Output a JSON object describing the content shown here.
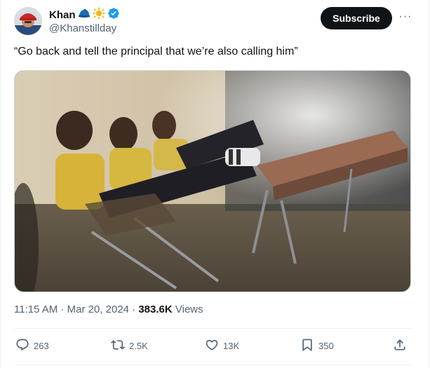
{
  "author": {
    "display_name": "Khan",
    "handle": "@Khanstillday",
    "badges": [
      "blue-cap-emoji-icon",
      "sun-emoji-icon",
      "verified-badge-icon"
    ]
  },
  "subscribe_label": "Subscribe",
  "more_label": "···",
  "tweet_text": "“Go back and tell the principal that we’re also calling him”",
  "meta": {
    "time": "11:15 AM",
    "separator1": " · ",
    "date": "Mar 20, 2024",
    "separator2": " · ",
    "views_count": "383.6K",
    "views_label": " Views"
  },
  "actions": {
    "reply": {
      "icon": "reply-icon",
      "count": "263"
    },
    "repost": {
      "icon": "repost-icon",
      "count": "2.5K"
    },
    "like": {
      "icon": "heart-icon",
      "count": "13K"
    },
    "bookmark": {
      "icon": "bookmark-icon",
      "count": "350"
    },
    "share": {
      "icon": "share-icon"
    }
  },
  "colors": {
    "accent_button": "#0f1419",
    "secondary_text": "#536471",
    "verified": "#1d9bf0"
  }
}
